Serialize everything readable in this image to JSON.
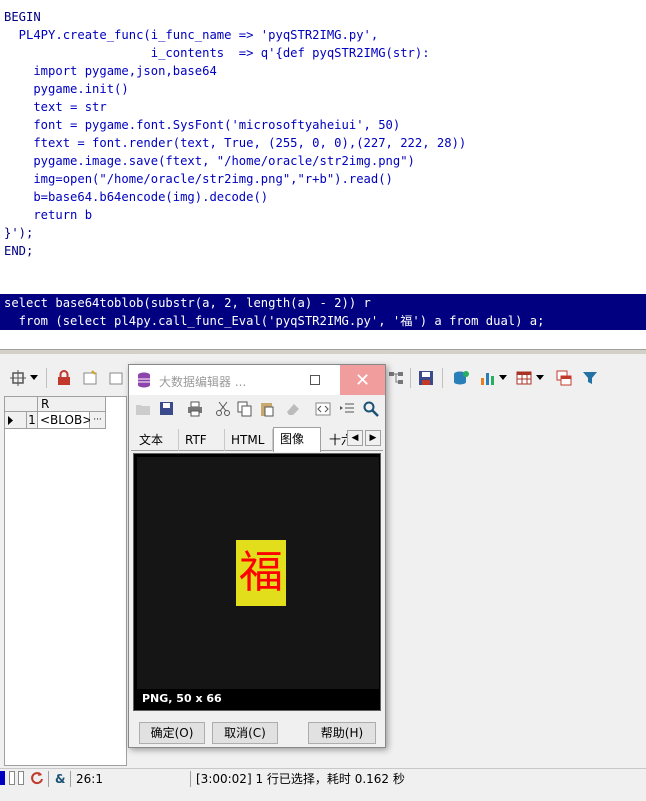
{
  "editor": {
    "lines": [
      "BEGIN",
      "  PL4PY.create_func(i_func_name => 'pyqSTR2IMG.py',",
      "                    i_contents  => q'{def pyqSTR2IMG(str):",
      "    import pygame,json,base64",
      "    pygame.init()",
      "    text = str",
      "    font = pygame.font.SysFont('microsoftyaheiui', 50)",
      "    ftext = font.render(text, True, (255, 0, 0),(227, 222, 28))",
      "    pygame.image.save(ftext, \"/home/oracle/str2img.png\")",
      "    img=open(\"/home/oracle/str2img.png\",\"r+b\").read()",
      "    b=base64.b64encode(img).decode()",
      "    return b",
      "}');",
      "END;"
    ],
    "selected_lines": [
      "select base64toblob(substr(a, 2, length(a) - 2)) r",
      "  from (select pl4py.call_func_Eval('pyqSTR2IMG.py', '福') a from dual) a;"
    ]
  },
  "grid": {
    "column_header": "R",
    "row_number": "1",
    "cell_value": "<BLOB>",
    "ellipsis": "···"
  },
  "dialog": {
    "title": "大数据编辑器 ...",
    "close_glyph": "✕",
    "tabs": [
      "文本",
      "RTF",
      "HTML",
      "图像",
      "十六"
    ],
    "active_tab": "图像",
    "image_char": "福",
    "image_info": "PNG, 50 x 66",
    "buttons": {
      "ok": "确定(O)",
      "cancel": "取消(C)",
      "help": "帮助(H)"
    }
  },
  "statusbar": {
    "ampersand": "&",
    "cursor_pos": "26:1",
    "message": "[3:00:02] 1 行已选择，耗时 0.162 秒"
  },
  "colors": {
    "selection_bg": "#000080",
    "image_bg": "#e3de1c",
    "image_fg": "#ff0000",
    "close_button": "#f19d9d"
  }
}
